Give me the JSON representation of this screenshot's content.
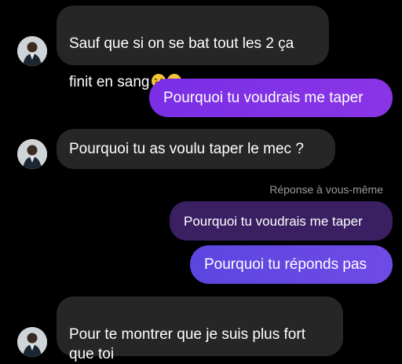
{
  "messages": [
    {
      "id": "m1",
      "direction": "incoming",
      "text": "Sauf que si on se bat tout les 2 ça\nfinit en sang",
      "emoji": [
        "rofl-emoji",
        "rofl-emoji"
      ]
    },
    {
      "id": "m2",
      "direction": "outgoing",
      "text": "Pourquoi tu voudrais me taper"
    },
    {
      "id": "m3",
      "direction": "incoming",
      "text": "Pourquoi tu as voulu taper le mec ?"
    },
    {
      "id": "m4",
      "direction": "outgoing",
      "reply_label": "Réponse à vous-même",
      "quoted_text": "Pourquoi tu voudrais me taper",
      "text": "Pourquoi tu réponds pas"
    },
    {
      "id": "m5",
      "direction": "incoming",
      "text": "Pour te montrer que je suis plus fort\nque toi"
    }
  ],
  "colors": {
    "background": "#000000",
    "incoming_bubble": "#262626",
    "outgoing_purple": "#8a34e6",
    "outgoing_blue": "#6f4ae6",
    "quoted_bubble": "#3a1f63"
  }
}
